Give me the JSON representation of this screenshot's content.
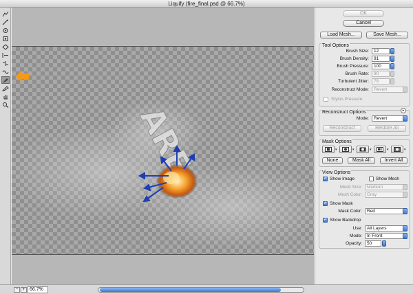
{
  "window": {
    "title": "Liquify (fire_final.psd @ 66.7%)"
  },
  "toolbox": {
    "tools": [
      {
        "name": "forward-warp-tool-icon",
        "active": false
      },
      {
        "name": "reconstruct-tool-icon",
        "active": false
      },
      {
        "name": "twirl-clockwise-tool-icon",
        "active": false
      },
      {
        "name": "pucker-tool-icon",
        "active": false
      },
      {
        "name": "bloat-tool-icon",
        "active": false
      },
      {
        "name": "push-left-tool-icon",
        "active": false
      },
      {
        "name": "mirror-tool-icon",
        "active": false
      },
      {
        "name": "turbulence-tool-icon",
        "active": false
      },
      {
        "name": "freeze-mask-tool-icon",
        "active": true
      },
      {
        "name": "thaw-mask-tool-icon",
        "active": false
      },
      {
        "name": "hand-tool-icon",
        "active": false
      },
      {
        "name": "zoom-tool-icon",
        "active": false
      }
    ]
  },
  "canvas": {
    "text_art": "ARE",
    "arrow_color": "#f39a1a",
    "direction_arrow_color": "#1f3fb0",
    "fire_color": "#f7a531"
  },
  "dialog": {
    "ok_label": "OK",
    "cancel_label": "Cancel",
    "load_mesh_label": "Load Mesh...",
    "save_mesh_label": "Save Mesh..."
  },
  "tool_options": {
    "title": "Tool Options",
    "brush_size_label": "Brush Size:",
    "brush_size": "12",
    "brush_density_label": "Brush Density:",
    "brush_density": "81",
    "brush_pressure_label": "Brush Pressure:",
    "brush_pressure": "100",
    "brush_rate_label": "Brush Rate:",
    "brush_rate": "80",
    "turbulent_jitter_label": "Turbulent Jitter:",
    "turbulent_jitter": "78",
    "reconstruct_mode_label": "Reconstruct Mode:",
    "reconstruct_mode": "Revert",
    "stylus_pressure_label": "Stylus Pressure"
  },
  "reconstruct_options": {
    "title": "Reconstruct Options",
    "mode_label": "Mode:",
    "mode": "Revert",
    "reconstruct_label": "Reconstruct",
    "restore_all_label": "Restore All"
  },
  "mask_options": {
    "title": "Mask Options",
    "none_label": "None",
    "mask_all_label": "Mask All",
    "invert_all_label": "Invert All"
  },
  "view_options": {
    "title": "View Options",
    "show_image_label": "Show Image",
    "show_mesh_label": "Show Mesh",
    "mesh_size_label": "Mesh Size:",
    "mesh_size": "Medium",
    "mesh_color_label": "Mesh Color:",
    "mesh_color": "Gray",
    "show_mask_label": "Show Mask",
    "mask_color_label": "Mask Color:",
    "mask_color": "Red",
    "show_backdrop_label": "Show Backdrop",
    "use_label": "Use:",
    "use": "All Layers",
    "backdrop_mode_label": "Mode:",
    "backdrop_mode": "In Front",
    "opacity_label": "Opacity:",
    "opacity": "50"
  },
  "statusbar": {
    "zoom_out_label": "−",
    "zoom_in_label": "+",
    "zoom": "66.7%",
    "scroll_position": 0.07,
    "scroll_thumb_fraction": 0.96
  }
}
